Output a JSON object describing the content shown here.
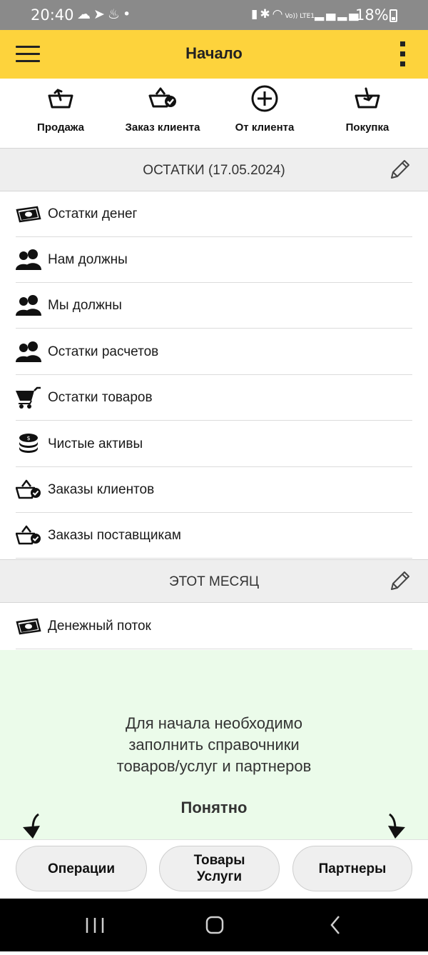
{
  "status_bar": {
    "time": "20:40",
    "battery_percent": "18%",
    "left_icons": [
      "cloud-icon",
      "telegram-icon",
      "flame-icon",
      "dot-icon"
    ],
    "right_icons": [
      "sim-icon",
      "bluetooth-icon",
      "wifi-icon",
      "volte-icon",
      "signal-icon",
      "signal-icon",
      "battery-icon"
    ],
    "volte_label": "Vo)) LTE1"
  },
  "app_bar": {
    "title": "Начало",
    "background": "#fdd33c"
  },
  "quick_actions": [
    {
      "label": "Продажа",
      "icon": "basket-out-icon"
    },
    {
      "label": "Заказ клиента",
      "icon": "basket-check-icon"
    },
    {
      "label": "От клиента",
      "icon": "plus-circle-icon"
    },
    {
      "label": "Покупка",
      "icon": "basket-in-icon"
    }
  ],
  "balances_section": {
    "title": "ОСТАТКИ (17.05.2024)",
    "items": [
      {
        "label": "Остатки денег",
        "icon": "money-icon"
      },
      {
        "label": "Нам должны",
        "icon": "people-icon"
      },
      {
        "label": "Мы должны",
        "icon": "people-icon"
      },
      {
        "label": "Остатки расчетов",
        "icon": "people-icon"
      },
      {
        "label": "Остатки товаров",
        "icon": "cart-icon"
      },
      {
        "label": "Чистые активы",
        "icon": "coins-stack-icon"
      },
      {
        "label": "Заказы клиентов",
        "icon": "basket-check-icon"
      },
      {
        "label": "Заказы поставщикам",
        "icon": "basket-check-icon"
      }
    ]
  },
  "month_section": {
    "title": "ЭТОТ МЕСЯЦ",
    "items": [
      {
        "label": "Денежный поток",
        "icon": "money-icon"
      }
    ]
  },
  "info_panel": {
    "lines": [
      "Для начала необходимо",
      "заполнить справочники",
      "товаров/услуг и партнеров"
    ],
    "confirm": "Понятно",
    "background": "#ebfbea"
  },
  "bottom_tabs": {
    "operations": "Операции",
    "goods_line1": "Товары",
    "goods_line2": "Услуги",
    "partners": "Партнеры"
  },
  "nav_bar": [
    "recents-icon",
    "home-icon",
    "back-icon"
  ]
}
